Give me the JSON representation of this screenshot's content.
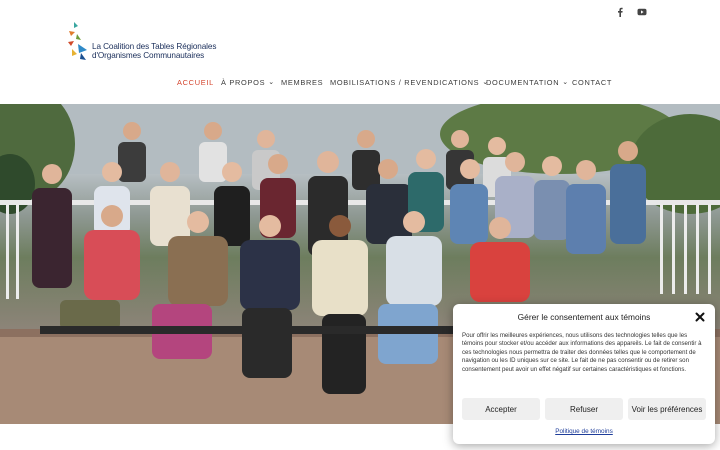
{
  "social": {
    "facebook_icon": "facebook-icon",
    "youtube_icon": "youtube-icon"
  },
  "logo": {
    "line1": "La Coalition des Tables Régionales",
    "line2": "d'Organismes Communautaires"
  },
  "nav": {
    "items": [
      {
        "label": "ACCUEIL",
        "active": true,
        "dropdown": false
      },
      {
        "label": "À PROPOS",
        "active": false,
        "dropdown": true
      },
      {
        "label": "MEMBRES",
        "active": false,
        "dropdown": false
      },
      {
        "label": "MOBILISATIONS / REVENDICATIONS",
        "active": false,
        "dropdown": true
      },
      {
        "label": "DOCUMENTATION",
        "active": false,
        "dropdown": true
      },
      {
        "label": "CONTACT",
        "active": false,
        "dropdown": false
      }
    ]
  },
  "hero": {
    "image_description_icon": "group-photo-image"
  },
  "cookie": {
    "title": "Gérer le consentement aux témoins",
    "body": "Pour offrir les meilleures expériences, nous utilisons des technologies telles que les témoins pour stocker et/ou accéder aux informations des appareils. Le fait de consentir à ces technologies nous permettra de traiter des données telles que le comportement de navigation ou les ID uniques sur ce site. Le fait de ne pas consentir ou de retirer son consentement peut avoir un effet négatif sur certaines caractéristiques et fonctions.",
    "accept_label": "Accepter",
    "refuse_label": "Refuser",
    "prefs_label": "Voir les préférences",
    "policy_link": "Politique de témoins"
  },
  "colors": {
    "accent": "#d4442d",
    "nav_text": "#3b3b3b",
    "logo_text": "#1a2e5a",
    "link": "#1e3d9a"
  }
}
